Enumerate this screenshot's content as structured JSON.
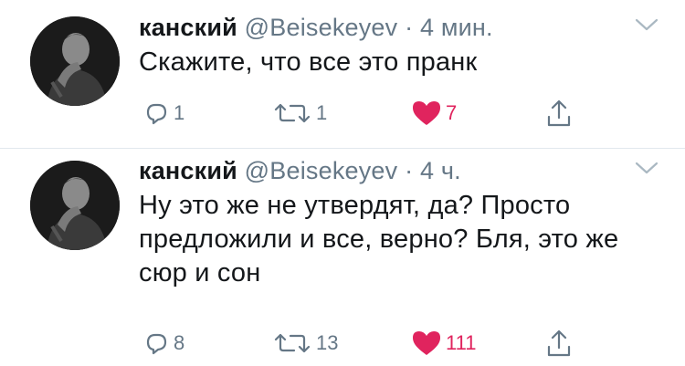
{
  "colors": {
    "like": "#e0245e",
    "secondary": "#657786",
    "divider": "#e1e8ed"
  },
  "tweets": [
    {
      "author_name": "канский",
      "handle": "@Beisekeyev",
      "separator": "·",
      "time": "4 мин.",
      "text_lines": [
        "Скажите, что все это пранк"
      ],
      "replies": "1",
      "retweets": "1",
      "likes": "7",
      "liked": true
    },
    {
      "author_name": "канский",
      "handle": "@Beisekeyev",
      "separator": "·",
      "time": "4 ч.",
      "text_lines": [
        "Ну это же не утвердят, да? Просто",
        "предложили и все, верно? Бля, это же",
        "сюр и сон"
      ],
      "replies": "8",
      "retweets": "13",
      "likes": "111",
      "liked": true
    }
  ]
}
